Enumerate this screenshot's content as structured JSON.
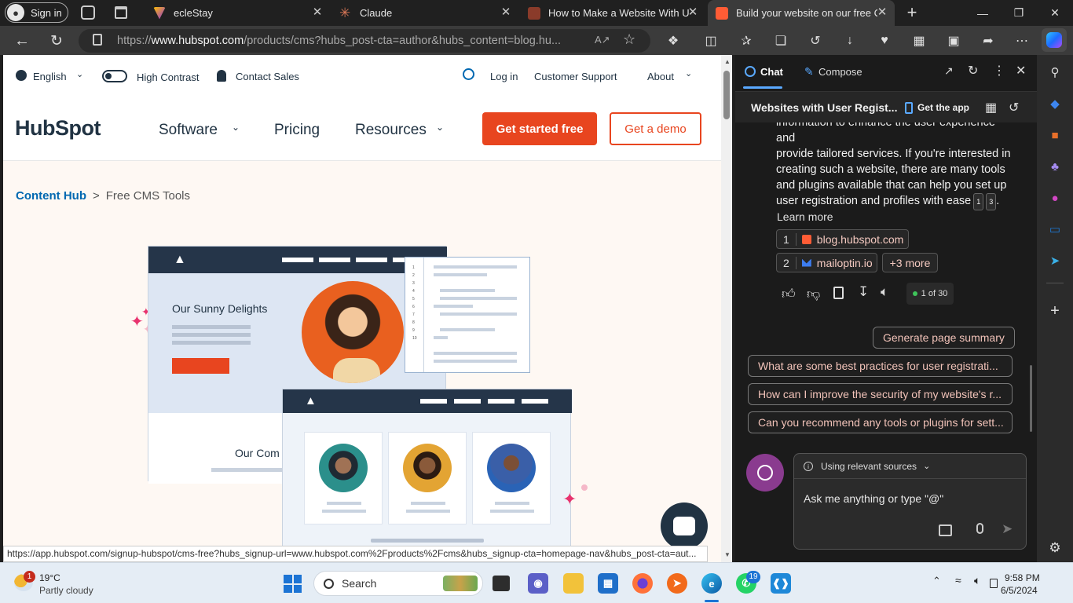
{
  "browser": {
    "profile_label": "Sign in",
    "tabs": [
      {
        "title": "ecleStay",
        "favicon": "ecle-icon"
      },
      {
        "title": "Claude",
        "favicon": "claude-icon"
      },
      {
        "title": "How to Make a Website With Us",
        "favicon": "hubspot-icon"
      },
      {
        "title": "Build your website on our free Cl",
        "favicon": "hubspot-icon",
        "active": true
      }
    ],
    "url_prefix": "https://",
    "url_domain": "www.hubspot.com",
    "url_rest": "/products/cms?hubs_post-cta=author&hubs_content=blog.hu...",
    "status_url": "https://app.hubspot.com/signup-hubspot/cms-free?hubs_signup-url=www.hubspot.com%2Fproducts%2Fcms&hubs_signup-cta=homepage-nav&hubs_post-cta=aut..."
  },
  "site": {
    "util": {
      "language": "English",
      "contrast": "High Contrast",
      "contact": "Contact Sales",
      "login": "Log in",
      "support": "Customer Support",
      "about": "About"
    },
    "logo": "HubSpot",
    "nav": {
      "software": "Software",
      "pricing": "Pricing",
      "resources": "Resources",
      "cta_primary": "Get started free",
      "cta_secondary": "Get a demo"
    },
    "breadcrumb": {
      "parent": "Content Hub",
      "sep": ">",
      "current": "Free CMS Tools"
    },
    "illustration": {
      "heading": "Our Sunny Delights",
      "heading2": "Our Com",
      "code_lines": [
        "1",
        "2",
        "3",
        "4",
        "5",
        "6",
        "7",
        "8",
        "9",
        "10"
      ]
    }
  },
  "copilot": {
    "tab_chat": "Chat",
    "tab_compose": "Compose",
    "conversation_title": "Websites with User Regist...",
    "get_app": "Get the app",
    "answer_lines": [
      "information to enhance the user experience and",
      "provide tailored services. If you're interested in",
      "creating such a website, there are many tools",
      "and plugins available that can help you set up",
      "user registration and profiles with ease"
    ],
    "cite_1": "1",
    "cite_3": "3",
    "learn_more": "Learn more",
    "sources": [
      {
        "num": "1",
        "label": "blog.hubspot.com"
      },
      {
        "num": "2",
        "label": "mailoptin.io"
      }
    ],
    "more_sources": "+3 more",
    "counter": "1 of 30",
    "suggestions": [
      "Generate page summary",
      "What are some best practices for user registrati...",
      "How can I improve the security of my website's r...",
      "Can you recommend any tools or plugins for sett..."
    ],
    "sources_mode": "Using relevant sources",
    "input_placeholder": "Ask me anything or type \"@\""
  },
  "taskbar": {
    "weather_temp": "19°C",
    "weather_desc": "Partly cloudy",
    "weather_badge": "1",
    "search_label": "Search",
    "whatsapp_badge": "19",
    "time": "9:58 PM",
    "date": "6/5/2024"
  },
  "colors": {
    "hubspot_orange": "#e8451f",
    "hubspot_navy": "#213343",
    "link_blue": "#0068b1",
    "copilot_bg": "#1b1b1b",
    "suggestion_text": "#f2c3b9"
  }
}
